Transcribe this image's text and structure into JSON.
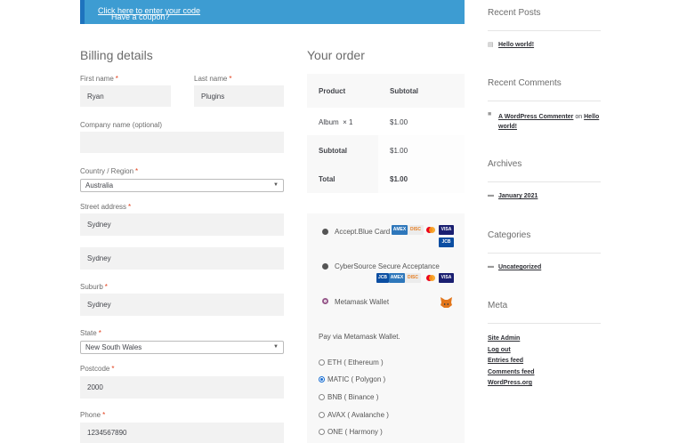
{
  "coupon": {
    "prefix": "Have a coupon? ",
    "link": "Click here to enter your code"
  },
  "billing": {
    "title": "Billing details",
    "first_name": {
      "label": "First name",
      "value": "Ryan"
    },
    "last_name": {
      "label": "Last name",
      "value": "Plugins"
    },
    "company": {
      "label": "Company name (optional)",
      "value": ""
    },
    "country": {
      "label": "Country / Region",
      "value": "Australia"
    },
    "street": {
      "label": "Street address",
      "value1": "Sydney",
      "value2": "Sydney"
    },
    "suburb": {
      "label": "Suburb",
      "value": "Sydney"
    },
    "state": {
      "label": "State",
      "value": "New South Wales"
    },
    "postcode": {
      "label": "Postcode",
      "value": "2000"
    },
    "phone": {
      "label": "Phone",
      "value": "1234567890"
    },
    "required_mark": "*"
  },
  "order": {
    "title": "Your order",
    "col_product": "Product",
    "col_subtotal": "Subtotal",
    "item_name": "Album",
    "item_qty": "× 1",
    "item_price": "$1.00",
    "subtotal_label": "Subtotal",
    "subtotal_value": "$1.00",
    "total_label": "Total",
    "total_value": "$1.00"
  },
  "payment": {
    "methods": [
      "Accept.Blue Card",
      "CyberSource Secure Acceptance",
      "Metamask Wallet"
    ],
    "pay_via": "Pay via Metamask Wallet.",
    "networks": [
      "ETH ( Ethereum )",
      "MATIC ( Polygon )",
      "BNB ( Binance )",
      "AVAX ( Avalanche )",
      "ONE ( Harmony )"
    ],
    "selected_network": "MATIC ( Polygon )",
    "cards": {
      "amex": "AMEX",
      "discover": "DISC",
      "visa": "VISA",
      "jcb": "JCB"
    }
  },
  "sidebar": {
    "recent_posts": {
      "title": "Recent Posts",
      "items": [
        "Hello world!"
      ]
    },
    "recent_comments": {
      "title": "Recent Comments",
      "author": "A WordPress Commenter",
      "on": "on",
      "post": "Hello world!"
    },
    "archives": {
      "title": "Archives",
      "items": [
        "January 2021"
      ]
    },
    "categories": {
      "title": "Categories",
      "items": [
        "Uncategorized"
      ]
    },
    "meta": {
      "title": "Meta",
      "items": [
        "Site Admin",
        "Log out",
        "Entries feed",
        "Comments feed",
        "WordPress.org"
      ]
    }
  }
}
